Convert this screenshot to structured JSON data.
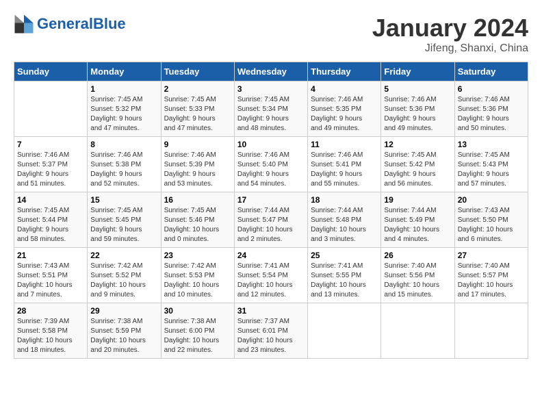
{
  "logo": {
    "text_general": "General",
    "text_blue": "Blue"
  },
  "header": {
    "title": "January 2024",
    "subtitle": "Jifeng, Shanxi, China"
  },
  "days_of_week": [
    "Sunday",
    "Monday",
    "Tuesday",
    "Wednesday",
    "Thursday",
    "Friday",
    "Saturday"
  ],
  "weeks": [
    [
      {
        "day": "",
        "sunrise": "",
        "sunset": "",
        "daylight": ""
      },
      {
        "day": "1",
        "sunrise": "Sunrise: 7:45 AM",
        "sunset": "Sunset: 5:32 PM",
        "daylight": "Daylight: 9 hours and 47 minutes."
      },
      {
        "day": "2",
        "sunrise": "Sunrise: 7:45 AM",
        "sunset": "Sunset: 5:33 PM",
        "daylight": "Daylight: 9 hours and 47 minutes."
      },
      {
        "day": "3",
        "sunrise": "Sunrise: 7:45 AM",
        "sunset": "Sunset: 5:34 PM",
        "daylight": "Daylight: 9 hours and 48 minutes."
      },
      {
        "day": "4",
        "sunrise": "Sunrise: 7:46 AM",
        "sunset": "Sunset: 5:35 PM",
        "daylight": "Daylight: 9 hours and 49 minutes."
      },
      {
        "day": "5",
        "sunrise": "Sunrise: 7:46 AM",
        "sunset": "Sunset: 5:36 PM",
        "daylight": "Daylight: 9 hours and 49 minutes."
      },
      {
        "day": "6",
        "sunrise": "Sunrise: 7:46 AM",
        "sunset": "Sunset: 5:36 PM",
        "daylight": "Daylight: 9 hours and 50 minutes."
      }
    ],
    [
      {
        "day": "7",
        "sunrise": "Sunrise: 7:46 AM",
        "sunset": "Sunset: 5:37 PM",
        "daylight": "Daylight: 9 hours and 51 minutes."
      },
      {
        "day": "8",
        "sunrise": "Sunrise: 7:46 AM",
        "sunset": "Sunset: 5:38 PM",
        "daylight": "Daylight: 9 hours and 52 minutes."
      },
      {
        "day": "9",
        "sunrise": "Sunrise: 7:46 AM",
        "sunset": "Sunset: 5:39 PM",
        "daylight": "Daylight: 9 hours and 53 minutes."
      },
      {
        "day": "10",
        "sunrise": "Sunrise: 7:46 AM",
        "sunset": "Sunset: 5:40 PM",
        "daylight": "Daylight: 9 hours and 54 minutes."
      },
      {
        "day": "11",
        "sunrise": "Sunrise: 7:46 AM",
        "sunset": "Sunset: 5:41 PM",
        "daylight": "Daylight: 9 hours and 55 minutes."
      },
      {
        "day": "12",
        "sunrise": "Sunrise: 7:45 AM",
        "sunset": "Sunset: 5:42 PM",
        "daylight": "Daylight: 9 hours and 56 minutes."
      },
      {
        "day": "13",
        "sunrise": "Sunrise: 7:45 AM",
        "sunset": "Sunset: 5:43 PM",
        "daylight": "Daylight: 9 hours and 57 minutes."
      }
    ],
    [
      {
        "day": "14",
        "sunrise": "Sunrise: 7:45 AM",
        "sunset": "Sunset: 5:44 PM",
        "daylight": "Daylight: 9 hours and 58 minutes."
      },
      {
        "day": "15",
        "sunrise": "Sunrise: 7:45 AM",
        "sunset": "Sunset: 5:45 PM",
        "daylight": "Daylight: 9 hours and 59 minutes."
      },
      {
        "day": "16",
        "sunrise": "Sunrise: 7:45 AM",
        "sunset": "Sunset: 5:46 PM",
        "daylight": "Daylight: 10 hours and 0 minutes."
      },
      {
        "day": "17",
        "sunrise": "Sunrise: 7:44 AM",
        "sunset": "Sunset: 5:47 PM",
        "daylight": "Daylight: 10 hours and 2 minutes."
      },
      {
        "day": "18",
        "sunrise": "Sunrise: 7:44 AM",
        "sunset": "Sunset: 5:48 PM",
        "daylight": "Daylight: 10 hours and 3 minutes."
      },
      {
        "day": "19",
        "sunrise": "Sunrise: 7:44 AM",
        "sunset": "Sunset: 5:49 PM",
        "daylight": "Daylight: 10 hours and 4 minutes."
      },
      {
        "day": "20",
        "sunrise": "Sunrise: 7:43 AM",
        "sunset": "Sunset: 5:50 PM",
        "daylight": "Daylight: 10 hours and 6 minutes."
      }
    ],
    [
      {
        "day": "21",
        "sunrise": "Sunrise: 7:43 AM",
        "sunset": "Sunset: 5:51 PM",
        "daylight": "Daylight: 10 hours and 7 minutes."
      },
      {
        "day": "22",
        "sunrise": "Sunrise: 7:42 AM",
        "sunset": "Sunset: 5:52 PM",
        "daylight": "Daylight: 10 hours and 9 minutes."
      },
      {
        "day": "23",
        "sunrise": "Sunrise: 7:42 AM",
        "sunset": "Sunset: 5:53 PM",
        "daylight": "Daylight: 10 hours and 10 minutes."
      },
      {
        "day": "24",
        "sunrise": "Sunrise: 7:41 AM",
        "sunset": "Sunset: 5:54 PM",
        "daylight": "Daylight: 10 hours and 12 minutes."
      },
      {
        "day": "25",
        "sunrise": "Sunrise: 7:41 AM",
        "sunset": "Sunset: 5:55 PM",
        "daylight": "Daylight: 10 hours and 13 minutes."
      },
      {
        "day": "26",
        "sunrise": "Sunrise: 7:40 AM",
        "sunset": "Sunset: 5:56 PM",
        "daylight": "Daylight: 10 hours and 15 minutes."
      },
      {
        "day": "27",
        "sunrise": "Sunrise: 7:40 AM",
        "sunset": "Sunset: 5:57 PM",
        "daylight": "Daylight: 10 hours and 17 minutes."
      }
    ],
    [
      {
        "day": "28",
        "sunrise": "Sunrise: 7:39 AM",
        "sunset": "Sunset: 5:58 PM",
        "daylight": "Daylight: 10 hours and 18 minutes."
      },
      {
        "day": "29",
        "sunrise": "Sunrise: 7:38 AM",
        "sunset": "Sunset: 5:59 PM",
        "daylight": "Daylight: 10 hours and 20 minutes."
      },
      {
        "day": "30",
        "sunrise": "Sunrise: 7:38 AM",
        "sunset": "Sunset: 6:00 PM",
        "daylight": "Daylight: 10 hours and 22 minutes."
      },
      {
        "day": "31",
        "sunrise": "Sunrise: 7:37 AM",
        "sunset": "Sunset: 6:01 PM",
        "daylight": "Daylight: 10 hours and 23 minutes."
      },
      {
        "day": "",
        "sunrise": "",
        "sunset": "",
        "daylight": ""
      },
      {
        "day": "",
        "sunrise": "",
        "sunset": "",
        "daylight": ""
      },
      {
        "day": "",
        "sunrise": "",
        "sunset": "",
        "daylight": ""
      }
    ]
  ]
}
